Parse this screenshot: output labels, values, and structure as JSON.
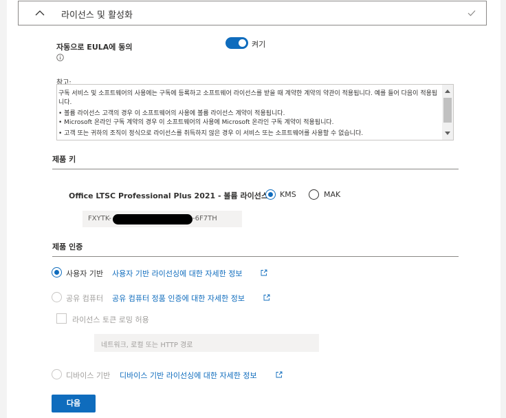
{
  "panel": {
    "title": "라이선스 및 활성화"
  },
  "eula": {
    "label": "자동으로 EULA에 동의",
    "toggle_state": "켜기",
    "toggle_on": true
  },
  "note": {
    "label": "참고:",
    "paragraphs": [
      "구독 서비스 및 소프트웨어의 사용에는 구독에 등록하고 소프트웨어 라이선스를 받을 때 계약한 계약의 약관이 적용됩니다. 예를 들어 다음이 적용됩니다.",
      "• 볼륨 라이선스 고객의 경우 이 소프트웨어의 사용에 볼륨 라이선스 계약이 적용됩니다.\n• Microsoft 온라인 구독 계약의 경우 이 소프트웨어의 사용에 Microsoft 온라인 구독 계약이 적용됩니다.",
      "• 고객 또는 귀하의 조직이 정식으로 라이선스를 취득하지 않은 경우 이 서비스 또는 소프트웨어를 사용할 수 없습니다."
    ]
  },
  "product_key": {
    "section_title": "제품 키",
    "product_name": "Office LTSC Professional Plus 2021 - 볼륨 라이선스",
    "options": [
      {
        "label": "KMS",
        "selected": true
      },
      {
        "label": "MAK",
        "selected": false
      }
    ],
    "key_prefix": "FXYTK-",
    "key_suffix": "-6F7TH"
  },
  "activation": {
    "section_title": "제품 인증",
    "user_based": {
      "label": "사용자 기반",
      "link": "사용자 기반 라이선싱에 대한 자세한 정보",
      "selected": true
    },
    "shared_computer": {
      "label": "공유 컴퓨터",
      "link": "공유 컴퓨터 정품 인증에 대한 자세한 정보",
      "selected": false
    },
    "token_roaming": {
      "label": "라이선스 토큰 로밍 허용",
      "checked": false
    },
    "path_placeholder": "네트워크, 로컬 또는 HTTP 경로",
    "device_based": {
      "label": "디바이스 기반",
      "link": "디바이스 기반 라이선싱에 대한 자세한 정보",
      "selected": false
    }
  },
  "next_button": "다음",
  "icons": {
    "collapse": "chevron-up-icon",
    "complete": "checkmark-icon",
    "info": "info-icon",
    "external": "external-link-icon"
  },
  "colors": {
    "accent": "#0f6cbd",
    "disabled": "#a19f9d",
    "field_bg": "#f3f2f1"
  }
}
